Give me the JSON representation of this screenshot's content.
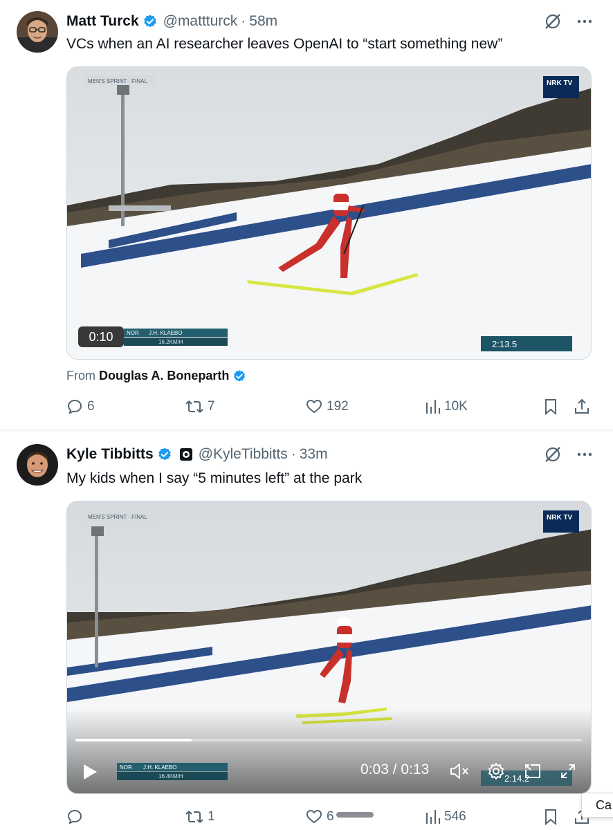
{
  "tweets": [
    {
      "author": "Matt Turck",
      "handle": "@mattturck",
      "dot": "·",
      "time": "58m",
      "text": "VCs when an AI researcher leaves OpenAI to “start something new”",
      "video": {
        "duration_badge": "0:10",
        "overlay": {
          "event_label": "MEN'S SPRINT · FINAL",
          "broadcaster": "NRK TV",
          "athlete_prefix": "NOR",
          "athlete": "J.H. KLAEBO",
          "speed": "16.2KM/H",
          "race_time": "2:13.5"
        }
      },
      "from_label": "From",
      "from_name": "Douglas A. Boneparth",
      "stats": {
        "replies": "6",
        "reposts": "7",
        "likes": "192",
        "views": "10K"
      }
    },
    {
      "author": "Kyle Tibbitts",
      "handle": "@KyleTibbitts",
      "dot": "·",
      "time": "33m",
      "text": "My kids when I say “5 minutes left” at the park",
      "video": {
        "current_time": "0:03 / 0:13",
        "progress_fraction": 0.23,
        "overlay": {
          "event_label": "MEN'S SPRINT · FINAL",
          "broadcaster": "NRK TV",
          "athlete_prefix": "NOR",
          "athlete": "J.H. KLAEBO",
          "speed": "16.4KM/H",
          "race_time": "2:14.2"
        }
      },
      "stats": {
        "replies": "",
        "reposts": "1",
        "likes": "6",
        "views": "546"
      }
    }
  ],
  "tooltip_text": "Ca",
  "colors": {
    "verified": "#1d9bf0",
    "secondary_text": "#536471",
    "primary_text": "#0f1419",
    "divider": "#eff3f4"
  },
  "icons": [
    "verified-badge-icon",
    "grok-icon",
    "more-icon",
    "reply-icon",
    "repost-icon",
    "like-icon",
    "views-icon",
    "bookmark-icon",
    "share-icon",
    "play-icon",
    "mute-icon",
    "settings-icon",
    "pip-icon",
    "fullscreen-icon"
  ]
}
